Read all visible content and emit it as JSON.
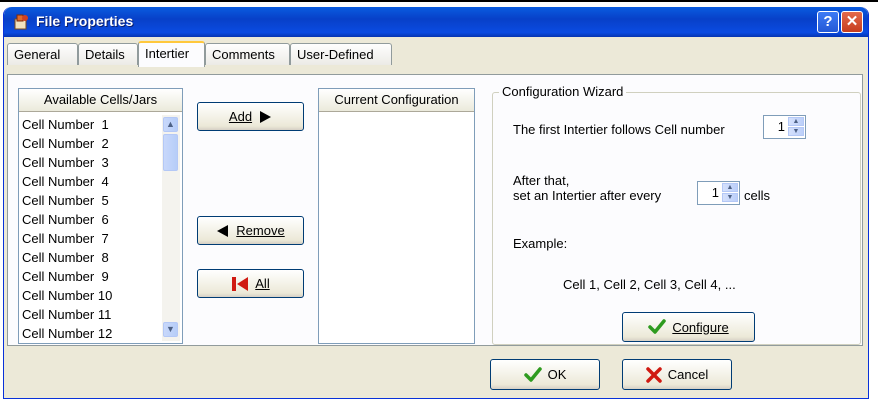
{
  "window": {
    "title": "File Properties"
  },
  "tabs": [
    "General",
    "Details",
    "Intertier",
    "Comments",
    "User-Defined"
  ],
  "available_list": {
    "header": "Available Cells/Jars",
    "items": [
      "Cell Number  1",
      "Cell Number  2",
      "Cell Number  3",
      "Cell Number  4",
      "Cell Number  5",
      "Cell Number  6",
      "Cell Number  7",
      "Cell Number  8",
      "Cell Number  9",
      "Cell Number 10",
      "Cell Number 11",
      "Cell Number 12"
    ]
  },
  "current_list": {
    "header": "Current Configuration"
  },
  "buttons": {
    "add": "Add",
    "remove": "Remove",
    "all": "All",
    "configure": "Configure",
    "ok": "OK",
    "cancel": "Cancel"
  },
  "wizard": {
    "title": "Configuration Wizard",
    "first_label": "The first Intertier follows Cell number",
    "first_value": "1",
    "after_line1": "After that,",
    "after_line2": "set an Intertier after every",
    "after_value": "1",
    "after_unit": "cells",
    "example_label": "Example:",
    "example_text": "Cell 1,  Cell 2,  Cell 3,  Cell 4,  ..."
  },
  "colors": {
    "accent_tab": "#ffc83c",
    "check_green": "#2e9b1f",
    "cancel_red": "#d01a12"
  }
}
